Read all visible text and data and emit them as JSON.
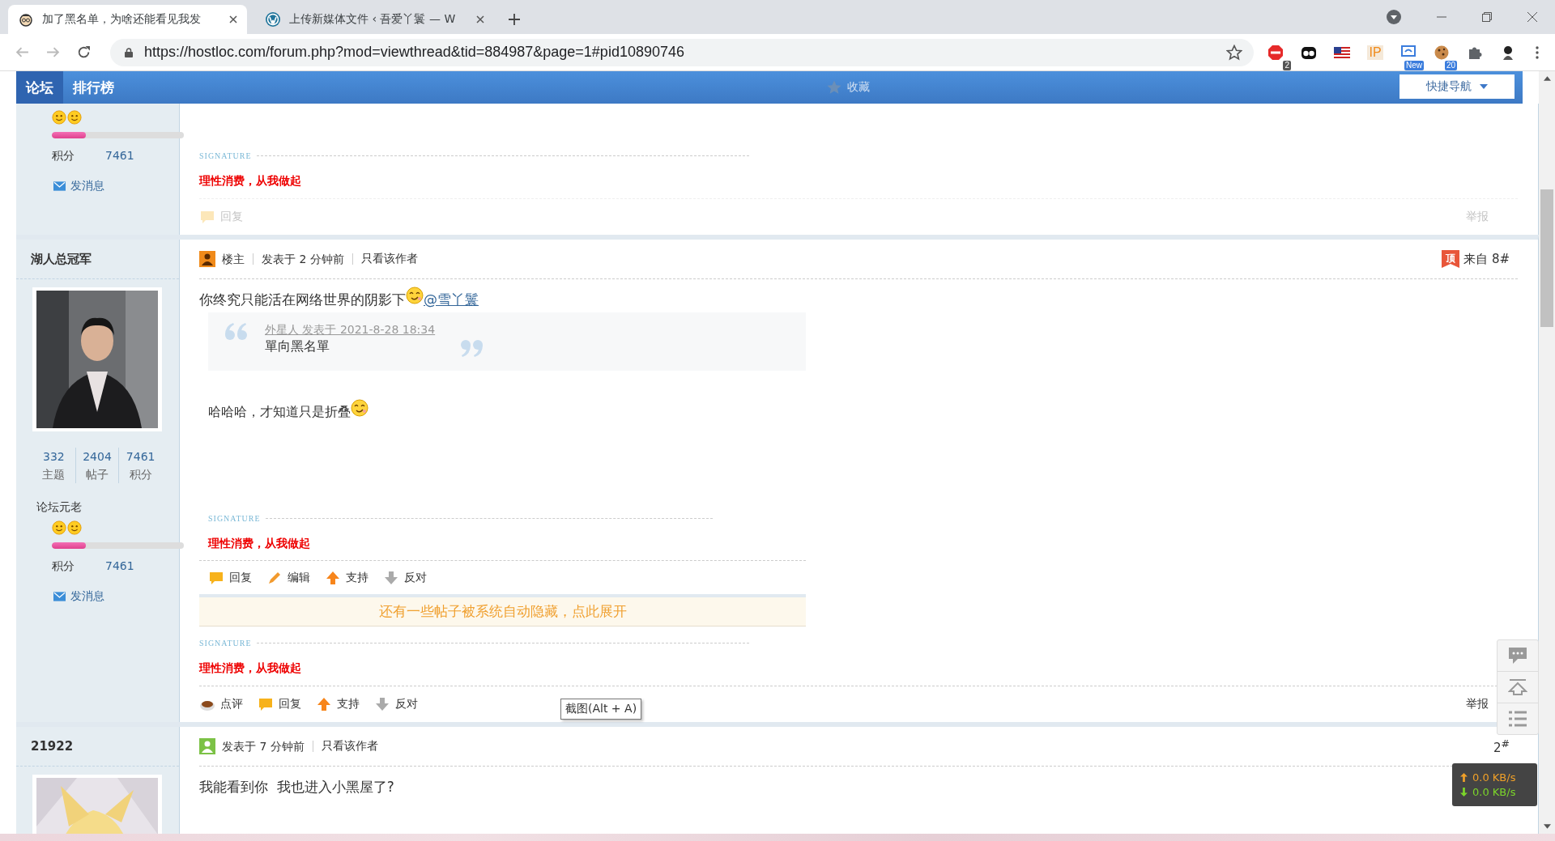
{
  "browser": {
    "tabs": [
      {
        "title": "加了黑名单，为啥还能看见我发",
        "selected": true
      },
      {
        "title": "上传新媒体文件 ‹ 吾爱丫鬟 — W",
        "selected": false
      }
    ],
    "url": "https://hostloc.com/forum.php?mod=viewthread&tid=884987&page=1#pid10890746",
    "extensions": [
      {
        "kind": "adblock",
        "badge": "2"
      },
      {
        "kind": "ghost"
      },
      {
        "kind": "flag"
      },
      {
        "kind": "ip",
        "label": "IP"
      },
      {
        "kind": "screen",
        "badge": "New"
      },
      {
        "kind": "cookie",
        "badge": "20"
      },
      {
        "kind": "puzzle"
      },
      {
        "kind": "profile"
      }
    ]
  },
  "forum_nav": {
    "items": [
      {
        "label": "论坛",
        "selected": true
      },
      {
        "label": "排行榜",
        "selected": false
      }
    ],
    "favorite": "收藏",
    "quick_nav": "快捷导航"
  },
  "posts": [
    {
      "sidebar": {
        "rank_icons": [
          {
            "kind": "smiley"
          },
          {
            "kind": "smiley"
          }
        ],
        "level": 0.26,
        "score_label": "积分",
        "score": "7461",
        "message": "发消息"
      },
      "blocks": [
        {
          "kind": "signature",
          "label": "SIGNATURE",
          "text": "理性消费，从我做起"
        },
        {
          "kind": "actions",
          "dimmed": true,
          "items": [
            {
              "kind": "reply",
              "label": "回复"
            }
          ],
          "report": "举报"
        }
      ]
    },
    {
      "sidebar": {
        "author": "湖人总冠军",
        "stats": [
          {
            "value": "332",
            "label": "主题"
          },
          {
            "value": "2404",
            "label": "帖子"
          },
          {
            "value": "7461",
            "label": "积分"
          }
        ],
        "rank": "论坛元老",
        "rank_icons": [
          {
            "kind": "smiley"
          },
          {
            "kind": "smiley"
          }
        ],
        "level": 0.26,
        "score_label": "积分",
        "score": "7461",
        "message": "发消息"
      },
      "header": {
        "kind": "owner",
        "owner_label": "楼主",
        "time": "发表于 2 分钟前",
        "author_only": "只看该作者",
        "floor_badge": "顶",
        "floor": "来自 8#"
      },
      "blocks": [
        {
          "kind": "text",
          "text": "你终究只能活在网络世界的阴影下",
          "emoji": true,
          "mention": "@雪丫鬟"
        },
        {
          "kind": "embedded",
          "blocks": [
            {
              "kind": "quote",
              "meta": "外星人 发表于 2021-8-28 18:34",
              "text": "單向黑名單"
            },
            {
              "kind": "text",
              "text": "哈哈哈，才知道只是折叠",
              "emoji": true
            },
            {
              "kind": "signature",
              "label": "SIGNATURE",
              "text": "理性消费，从我做起"
            },
            {
              "kind": "actions",
              "dimmed": false,
              "items": [
                {
                  "kind": "reply",
                  "label": "回复"
                },
                {
                  "kind": "edit",
                  "label": "编辑"
                },
                {
                  "kind": "up",
                  "label": "支持"
                },
                {
                  "kind": "down",
                  "label": "反对"
                }
              ]
            }
          ]
        },
        {
          "kind": "notice",
          "text": "还有一些帖子被系统自动隐藏，点此展开"
        },
        {
          "kind": "signature",
          "label": "SIGNATURE",
          "text": "理性消费，从我做起"
        },
        {
          "kind": "actions",
          "dimmed": false,
          "items": [
            {
              "kind": "comment",
              "label": "点评"
            },
            {
              "kind": "reply",
              "label": "回复"
            },
            {
              "kind": "up",
              "label": "支持"
            },
            {
              "kind": "down",
              "label": "反对"
            }
          ],
          "report": "举报"
        }
      ]
    },
    {
      "sidebar": {
        "author": "21922"
      },
      "header": {
        "kind": "member",
        "time": "发表于 7 分钟前",
        "author_only": "只看该作者",
        "floor": "2$^{#}$"
      },
      "blocks": [
        {
          "kind": "text",
          "text": "我能看到你  我也进入小黑屋了?"
        }
      ]
    }
  ],
  "tooltip": "截图(Alt + A)",
  "side_tools": [
    {
      "kind": "comment"
    },
    {
      "kind": "top"
    },
    {
      "kind": "list"
    }
  ],
  "net_speed": {
    "up": "0.0 KB/s",
    "down": "0.0 KB/s"
  }
}
